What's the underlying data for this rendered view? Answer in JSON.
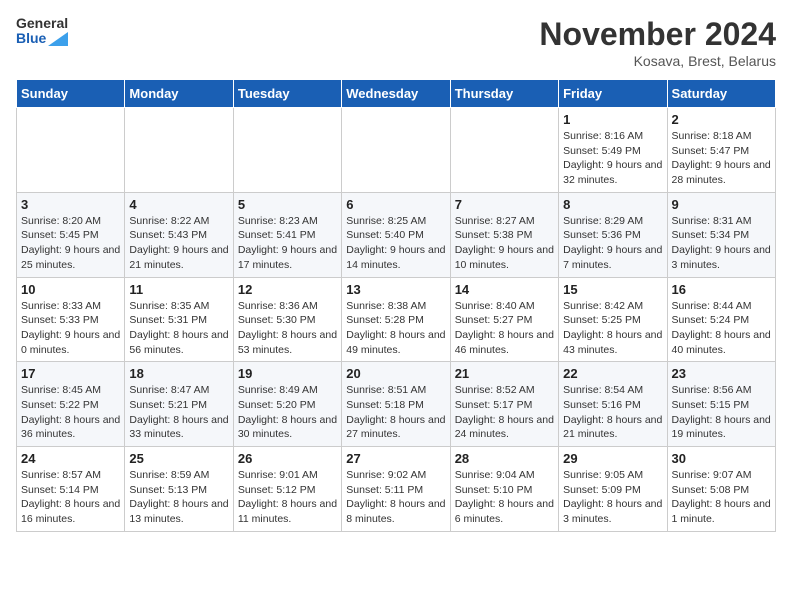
{
  "header": {
    "logo_line1": "General",
    "logo_line2": "Blue",
    "month_title": "November 2024",
    "location": "Kosava, Brest, Belarus"
  },
  "weekdays": [
    "Sunday",
    "Monday",
    "Tuesday",
    "Wednesday",
    "Thursday",
    "Friday",
    "Saturday"
  ],
  "weeks": [
    [
      {
        "day": "",
        "info": ""
      },
      {
        "day": "",
        "info": ""
      },
      {
        "day": "",
        "info": ""
      },
      {
        "day": "",
        "info": ""
      },
      {
        "day": "",
        "info": ""
      },
      {
        "day": "1",
        "info": "Sunrise: 8:16 AM\nSunset: 5:49 PM\nDaylight: 9 hours and 32 minutes."
      },
      {
        "day": "2",
        "info": "Sunrise: 8:18 AM\nSunset: 5:47 PM\nDaylight: 9 hours and 28 minutes."
      }
    ],
    [
      {
        "day": "3",
        "info": "Sunrise: 8:20 AM\nSunset: 5:45 PM\nDaylight: 9 hours and 25 minutes."
      },
      {
        "day": "4",
        "info": "Sunrise: 8:22 AM\nSunset: 5:43 PM\nDaylight: 9 hours and 21 minutes."
      },
      {
        "day": "5",
        "info": "Sunrise: 8:23 AM\nSunset: 5:41 PM\nDaylight: 9 hours and 17 minutes."
      },
      {
        "day": "6",
        "info": "Sunrise: 8:25 AM\nSunset: 5:40 PM\nDaylight: 9 hours and 14 minutes."
      },
      {
        "day": "7",
        "info": "Sunrise: 8:27 AM\nSunset: 5:38 PM\nDaylight: 9 hours and 10 minutes."
      },
      {
        "day": "8",
        "info": "Sunrise: 8:29 AM\nSunset: 5:36 PM\nDaylight: 9 hours and 7 minutes."
      },
      {
        "day": "9",
        "info": "Sunrise: 8:31 AM\nSunset: 5:34 PM\nDaylight: 9 hours and 3 minutes."
      }
    ],
    [
      {
        "day": "10",
        "info": "Sunrise: 8:33 AM\nSunset: 5:33 PM\nDaylight: 9 hours and 0 minutes."
      },
      {
        "day": "11",
        "info": "Sunrise: 8:35 AM\nSunset: 5:31 PM\nDaylight: 8 hours and 56 minutes."
      },
      {
        "day": "12",
        "info": "Sunrise: 8:36 AM\nSunset: 5:30 PM\nDaylight: 8 hours and 53 minutes."
      },
      {
        "day": "13",
        "info": "Sunrise: 8:38 AM\nSunset: 5:28 PM\nDaylight: 8 hours and 49 minutes."
      },
      {
        "day": "14",
        "info": "Sunrise: 8:40 AM\nSunset: 5:27 PM\nDaylight: 8 hours and 46 minutes."
      },
      {
        "day": "15",
        "info": "Sunrise: 8:42 AM\nSunset: 5:25 PM\nDaylight: 8 hours and 43 minutes."
      },
      {
        "day": "16",
        "info": "Sunrise: 8:44 AM\nSunset: 5:24 PM\nDaylight: 8 hours and 40 minutes."
      }
    ],
    [
      {
        "day": "17",
        "info": "Sunrise: 8:45 AM\nSunset: 5:22 PM\nDaylight: 8 hours and 36 minutes."
      },
      {
        "day": "18",
        "info": "Sunrise: 8:47 AM\nSunset: 5:21 PM\nDaylight: 8 hours and 33 minutes."
      },
      {
        "day": "19",
        "info": "Sunrise: 8:49 AM\nSunset: 5:20 PM\nDaylight: 8 hours and 30 minutes."
      },
      {
        "day": "20",
        "info": "Sunrise: 8:51 AM\nSunset: 5:18 PM\nDaylight: 8 hours and 27 minutes."
      },
      {
        "day": "21",
        "info": "Sunrise: 8:52 AM\nSunset: 5:17 PM\nDaylight: 8 hours and 24 minutes."
      },
      {
        "day": "22",
        "info": "Sunrise: 8:54 AM\nSunset: 5:16 PM\nDaylight: 8 hours and 21 minutes."
      },
      {
        "day": "23",
        "info": "Sunrise: 8:56 AM\nSunset: 5:15 PM\nDaylight: 8 hours and 19 minutes."
      }
    ],
    [
      {
        "day": "24",
        "info": "Sunrise: 8:57 AM\nSunset: 5:14 PM\nDaylight: 8 hours and 16 minutes."
      },
      {
        "day": "25",
        "info": "Sunrise: 8:59 AM\nSunset: 5:13 PM\nDaylight: 8 hours and 13 minutes."
      },
      {
        "day": "26",
        "info": "Sunrise: 9:01 AM\nSunset: 5:12 PM\nDaylight: 8 hours and 11 minutes."
      },
      {
        "day": "27",
        "info": "Sunrise: 9:02 AM\nSunset: 5:11 PM\nDaylight: 8 hours and 8 minutes."
      },
      {
        "day": "28",
        "info": "Sunrise: 9:04 AM\nSunset: 5:10 PM\nDaylight: 8 hours and 6 minutes."
      },
      {
        "day": "29",
        "info": "Sunrise: 9:05 AM\nSunset: 5:09 PM\nDaylight: 8 hours and 3 minutes."
      },
      {
        "day": "30",
        "info": "Sunrise: 9:07 AM\nSunset: 5:08 PM\nDaylight: 8 hours and 1 minute."
      }
    ]
  ]
}
